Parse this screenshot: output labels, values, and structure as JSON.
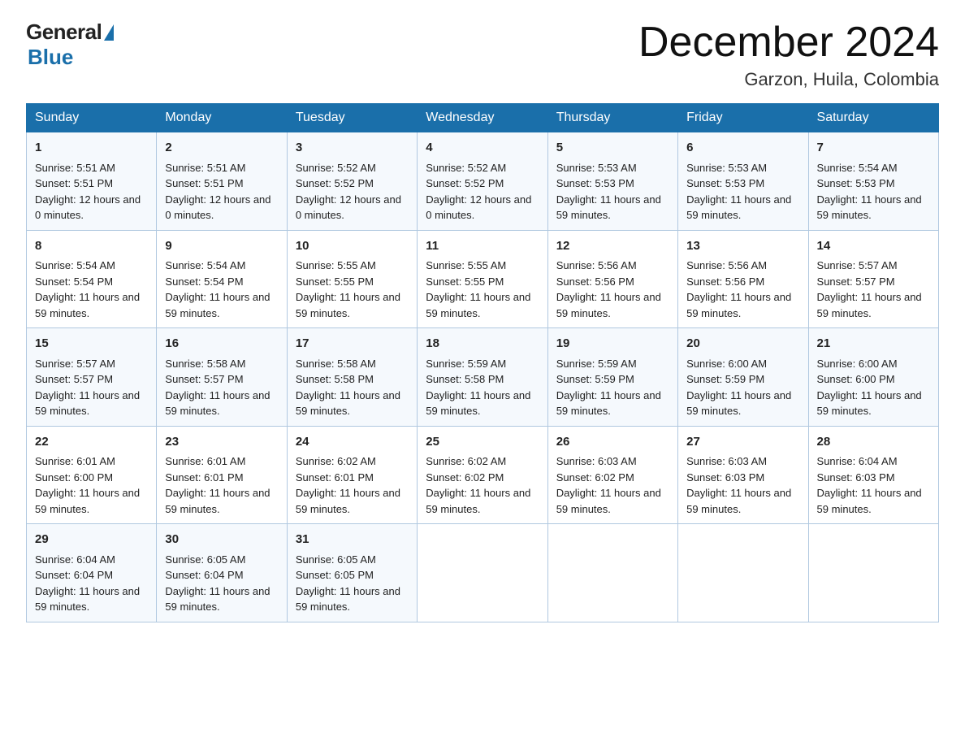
{
  "logo": {
    "general": "General",
    "blue": "Blue",
    "tagline": ""
  },
  "header": {
    "month_year": "December 2024",
    "location": "Garzon, Huila, Colombia"
  },
  "days_of_week": [
    "Sunday",
    "Monday",
    "Tuesday",
    "Wednesday",
    "Thursday",
    "Friday",
    "Saturday"
  ],
  "weeks": [
    [
      {
        "day": "1",
        "sunrise": "5:51 AM",
        "sunset": "5:51 PM",
        "daylight": "12 hours and 0 minutes."
      },
      {
        "day": "2",
        "sunrise": "5:51 AM",
        "sunset": "5:51 PM",
        "daylight": "12 hours and 0 minutes."
      },
      {
        "day": "3",
        "sunrise": "5:52 AM",
        "sunset": "5:52 PM",
        "daylight": "12 hours and 0 minutes."
      },
      {
        "day": "4",
        "sunrise": "5:52 AM",
        "sunset": "5:52 PM",
        "daylight": "12 hours and 0 minutes."
      },
      {
        "day": "5",
        "sunrise": "5:53 AM",
        "sunset": "5:53 PM",
        "daylight": "11 hours and 59 minutes."
      },
      {
        "day": "6",
        "sunrise": "5:53 AM",
        "sunset": "5:53 PM",
        "daylight": "11 hours and 59 minutes."
      },
      {
        "day": "7",
        "sunrise": "5:54 AM",
        "sunset": "5:53 PM",
        "daylight": "11 hours and 59 minutes."
      }
    ],
    [
      {
        "day": "8",
        "sunrise": "5:54 AM",
        "sunset": "5:54 PM",
        "daylight": "11 hours and 59 minutes."
      },
      {
        "day": "9",
        "sunrise": "5:54 AM",
        "sunset": "5:54 PM",
        "daylight": "11 hours and 59 minutes."
      },
      {
        "day": "10",
        "sunrise": "5:55 AM",
        "sunset": "5:55 PM",
        "daylight": "11 hours and 59 minutes."
      },
      {
        "day": "11",
        "sunrise": "5:55 AM",
        "sunset": "5:55 PM",
        "daylight": "11 hours and 59 minutes."
      },
      {
        "day": "12",
        "sunrise": "5:56 AM",
        "sunset": "5:56 PM",
        "daylight": "11 hours and 59 minutes."
      },
      {
        "day": "13",
        "sunrise": "5:56 AM",
        "sunset": "5:56 PM",
        "daylight": "11 hours and 59 minutes."
      },
      {
        "day": "14",
        "sunrise": "5:57 AM",
        "sunset": "5:57 PM",
        "daylight": "11 hours and 59 minutes."
      }
    ],
    [
      {
        "day": "15",
        "sunrise": "5:57 AM",
        "sunset": "5:57 PM",
        "daylight": "11 hours and 59 minutes."
      },
      {
        "day": "16",
        "sunrise": "5:58 AM",
        "sunset": "5:57 PM",
        "daylight": "11 hours and 59 minutes."
      },
      {
        "day": "17",
        "sunrise": "5:58 AM",
        "sunset": "5:58 PM",
        "daylight": "11 hours and 59 minutes."
      },
      {
        "day": "18",
        "sunrise": "5:59 AM",
        "sunset": "5:58 PM",
        "daylight": "11 hours and 59 minutes."
      },
      {
        "day": "19",
        "sunrise": "5:59 AM",
        "sunset": "5:59 PM",
        "daylight": "11 hours and 59 minutes."
      },
      {
        "day": "20",
        "sunrise": "6:00 AM",
        "sunset": "5:59 PM",
        "daylight": "11 hours and 59 minutes."
      },
      {
        "day": "21",
        "sunrise": "6:00 AM",
        "sunset": "6:00 PM",
        "daylight": "11 hours and 59 minutes."
      }
    ],
    [
      {
        "day": "22",
        "sunrise": "6:01 AM",
        "sunset": "6:00 PM",
        "daylight": "11 hours and 59 minutes."
      },
      {
        "day": "23",
        "sunrise": "6:01 AM",
        "sunset": "6:01 PM",
        "daylight": "11 hours and 59 minutes."
      },
      {
        "day": "24",
        "sunrise": "6:02 AM",
        "sunset": "6:01 PM",
        "daylight": "11 hours and 59 minutes."
      },
      {
        "day": "25",
        "sunrise": "6:02 AM",
        "sunset": "6:02 PM",
        "daylight": "11 hours and 59 minutes."
      },
      {
        "day": "26",
        "sunrise": "6:03 AM",
        "sunset": "6:02 PM",
        "daylight": "11 hours and 59 minutes."
      },
      {
        "day": "27",
        "sunrise": "6:03 AM",
        "sunset": "6:03 PM",
        "daylight": "11 hours and 59 minutes."
      },
      {
        "day": "28",
        "sunrise": "6:04 AM",
        "sunset": "6:03 PM",
        "daylight": "11 hours and 59 minutes."
      }
    ],
    [
      {
        "day": "29",
        "sunrise": "6:04 AM",
        "sunset": "6:04 PM",
        "daylight": "11 hours and 59 minutes."
      },
      {
        "day": "30",
        "sunrise": "6:05 AM",
        "sunset": "6:04 PM",
        "daylight": "11 hours and 59 minutes."
      },
      {
        "day": "31",
        "sunrise": "6:05 AM",
        "sunset": "6:05 PM",
        "daylight": "11 hours and 59 minutes."
      },
      null,
      null,
      null,
      null
    ]
  ]
}
